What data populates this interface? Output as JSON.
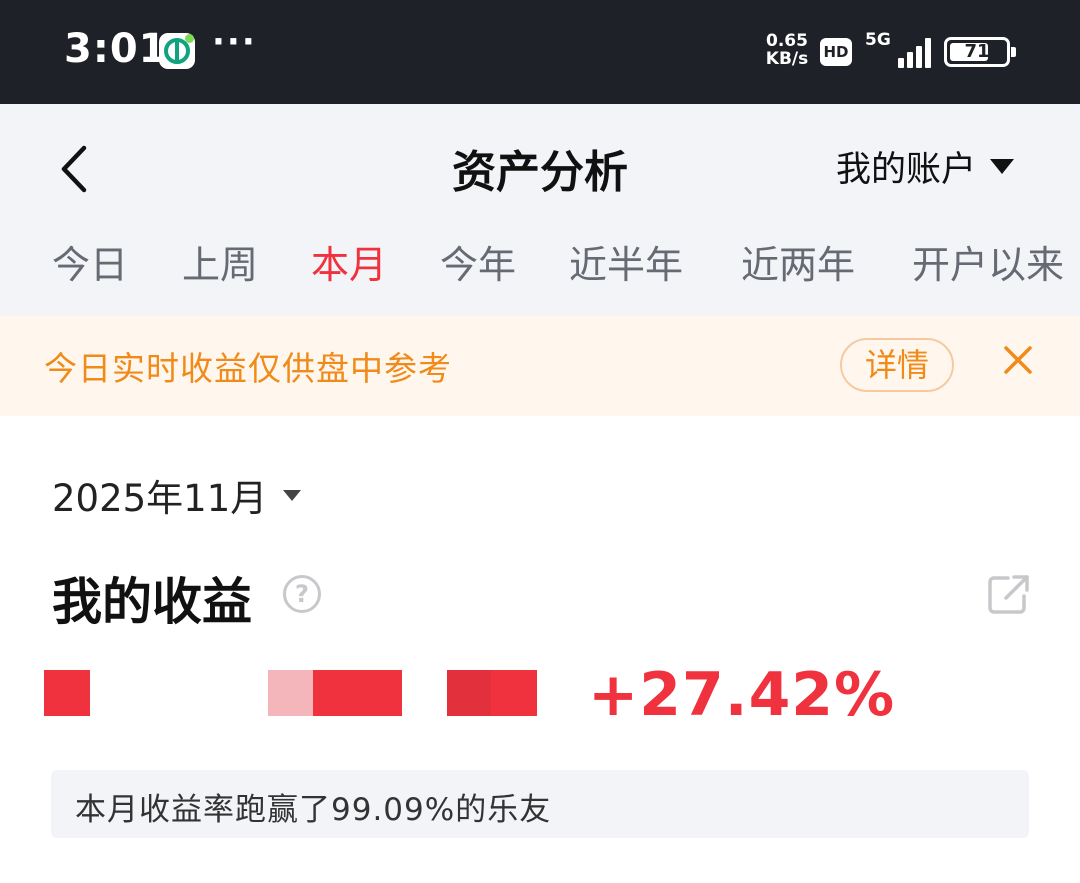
{
  "status_bar": {
    "time": "3:01",
    "dots": "···",
    "speed_line1": "0.65",
    "speed_line2": "KB/s",
    "hd": "HD",
    "network": "5G",
    "battery": "71",
    "battery_level": 0.71
  },
  "header": {
    "title": "资产分析",
    "account": "我的账户"
  },
  "tabs": [
    {
      "label": "今日",
      "active": false
    },
    {
      "label": "上周",
      "active": false
    },
    {
      "label": "本月",
      "active": true
    },
    {
      "label": "今年",
      "active": false
    },
    {
      "label": "近半年",
      "active": false
    },
    {
      "label": "近两年",
      "active": false
    },
    {
      "label": "开户以来",
      "active": false
    }
  ],
  "notice": {
    "text": "今日实时收益仅供盘中参考",
    "detail_label": "详情"
  },
  "content": {
    "month": "2025年11月",
    "earnings_title": "我的收益",
    "help_glyph": "?",
    "return_rate": "+27.42%",
    "rank_text": "本月收益率跑赢了99.09%的乐友"
  },
  "colors": {
    "accent_red": "#f0313e",
    "notice_orange": "#f08a19",
    "status_bg": "#1f2128",
    "header_bg": "#f3f4f8"
  },
  "icons": {
    "back": "chevron-left-icon",
    "account_caret": "caret-down-icon",
    "close": "close-icon",
    "help": "question-circle-icon",
    "share": "share-out-icon"
  }
}
